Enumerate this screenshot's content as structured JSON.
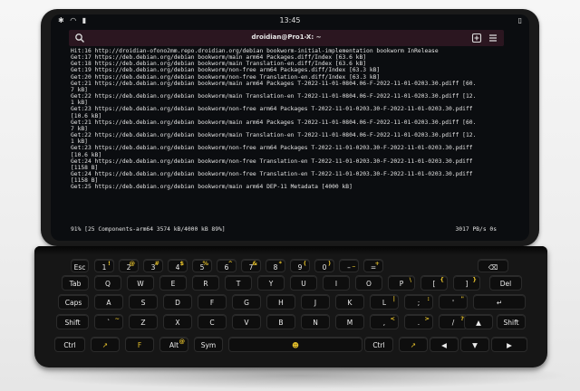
{
  "status": {
    "left_icons": [
      "bluetooth-icon",
      "wifi-icon",
      "signal-icon"
    ],
    "time": "13:45"
  },
  "terminal": {
    "title": "droidian@Pro1-X: ~",
    "lines": [
      "Hit:16 http://droidian-ofono2mm.repo.droidian.org/debian bookworm-initial-implementation bookworm InRelease",
      "Get:17 https://deb.debian.org/debian bookworm/main arm64 Packages.diff/Index [63.6 kB]",
      "Get:18 https://deb.debian.org/debian bookworm/main Translation-en.diff/Index [63.6 kB]",
      "Get:19 https://deb.debian.org/debian bookworm/non-free arm64 Packages.diff/Index [63.3 kB]",
      "Get:20 https://deb.debian.org/debian bookworm/non-free Translation-en.diff/Index [63.3 kB]",
      "Get:21 https://deb.debian.org/debian bookworm/main arm64 Packages T-2022-11-01-0804.06-F-2022-11-01-0203.30.pdiff [60.",
      "7 kB]",
      "Get:22 https://deb.debian.org/debian bookworm/main Translation-en T-2022-11-01-0804.06-F-2022-11-01-0203.30.pdiff [12.",
      "1 kB]",
      "Get:23 https://deb.debian.org/debian bookworm/non-free arm64 Packages T-2022-11-01-0203.30-F-2022-11-01-0203.30.pdiff",
      "[10.6 kB]",
      "Get:21 https://deb.debian.org/debian bookworm/main arm64 Packages T-2022-11-01-0804.06-F-2022-11-01-0203.30.pdiff [60.",
      "7 kB]",
      "Get:22 https://deb.debian.org/debian bookworm/main Translation-en T-2022-11-01-0804.06-F-2022-11-01-0203.30.pdiff [12.",
      "1 kB]",
      "Get:23 https://deb.debian.org/debian bookworm/non-free arm64 Packages T-2022-11-01-0203.30-F-2022-11-01-0203.30.pdiff",
      "[10.6 kB]",
      "Get:24 https://deb.debian.org/debian bookworm/non-free Translation-en T-2022-11-01-0203.30-F-2022-11-01-0203.30.pdiff",
      "[1158 B]",
      "Get:24 https://deb.debian.org/debian bookworm/non-free Translation-en T-2022-11-01-0203.30-F-2022-11-01-0203.30.pdiff",
      "[1158 B]",
      "Get:25 https://deb.debian.org/debian bookworm/main arm64 DEP-11 Metadata [4000 kB]"
    ],
    "progress": "91% [25 Components-arm64 3574 kB/4000 kB 89%]",
    "rate": "3017 PB/s 0s"
  },
  "keyboard": {
    "rows": [
      [
        {
          "id": "esc",
          "main": "Esc",
          "sub": ""
        },
        {
          "id": "1",
          "main": "1",
          "sub": "!"
        },
        {
          "id": "2",
          "main": "2",
          "sub": "@"
        },
        {
          "id": "3",
          "main": "3",
          "sub": "#"
        },
        {
          "id": "4",
          "main": "4",
          "sub": "$"
        },
        {
          "id": "5",
          "main": "5",
          "sub": "%"
        },
        {
          "id": "6",
          "main": "6",
          "sub": "^"
        },
        {
          "id": "7",
          "main": "7",
          "sub": "&"
        },
        {
          "id": "8",
          "main": "8",
          "sub": "*"
        },
        {
          "id": "9",
          "main": "9",
          "sub": "("
        },
        {
          "id": "0",
          "main": "0",
          "sub": ")"
        },
        {
          "id": "minus",
          "main": "–",
          "sub": "_"
        },
        {
          "id": "equals",
          "main": "=",
          "sub": "+"
        },
        {
          "id": "backspace",
          "main": "⌫",
          "sub": ""
        }
      ],
      [
        {
          "id": "tab",
          "main": "Tab",
          "sub": ""
        },
        {
          "id": "q",
          "main": "Q",
          "sub": ""
        },
        {
          "id": "w",
          "main": "W",
          "sub": ""
        },
        {
          "id": "e",
          "main": "E",
          "sub": ""
        },
        {
          "id": "r",
          "main": "R",
          "sub": ""
        },
        {
          "id": "t",
          "main": "T",
          "sub": ""
        },
        {
          "id": "y",
          "main": "Y",
          "sub": ""
        },
        {
          "id": "u",
          "main": "U",
          "sub": ""
        },
        {
          "id": "i",
          "main": "I",
          "sub": ""
        },
        {
          "id": "o",
          "main": "O",
          "sub": ""
        },
        {
          "id": "p",
          "main": "P",
          "sub": "\\"
        },
        {
          "id": "lbracket",
          "main": "[",
          "sub": "{"
        },
        {
          "id": "rbracket",
          "main": "]",
          "sub": "}"
        },
        {
          "id": "del",
          "main": "Del",
          "sub": ""
        }
      ],
      [
        {
          "id": "caps",
          "main": "Caps",
          "sub": ""
        },
        {
          "id": "a",
          "main": "A",
          "sub": ""
        },
        {
          "id": "s",
          "main": "S",
          "sub": ""
        },
        {
          "id": "d",
          "main": "D",
          "sub": ""
        },
        {
          "id": "f",
          "main": "F",
          "sub": ""
        },
        {
          "id": "g",
          "main": "G",
          "sub": ""
        },
        {
          "id": "h",
          "main": "H",
          "sub": ""
        },
        {
          "id": "j",
          "main": "J",
          "sub": ""
        },
        {
          "id": "k",
          "main": "K",
          "sub": ""
        },
        {
          "id": "l",
          "main": "L",
          "sub": "|"
        },
        {
          "id": "semicolon",
          "main": ";",
          "sub": ":"
        },
        {
          "id": "quote",
          "main": "'",
          "sub": "\""
        },
        {
          "id": "enter",
          "main": "↵",
          "sub": ""
        }
      ],
      [
        {
          "id": "shift-left",
          "main": "Shift",
          "sub": ""
        },
        {
          "id": "backtick",
          "main": "`",
          "sub": "~"
        },
        {
          "id": "z",
          "main": "Z",
          "sub": ""
        },
        {
          "id": "x",
          "main": "X",
          "sub": ""
        },
        {
          "id": "c",
          "main": "C",
          "sub": ""
        },
        {
          "id": "v",
          "main": "V",
          "sub": ""
        },
        {
          "id": "b",
          "main": "B",
          "sub": ""
        },
        {
          "id": "n",
          "main": "N",
          "sub": ""
        },
        {
          "id": "m",
          "main": "M",
          "sub": ""
        },
        {
          "id": "comma",
          "main": ",",
          "sub": "<"
        },
        {
          "id": "period",
          "main": ".",
          "sub": ">"
        },
        {
          "id": "slash",
          "main": "/",
          "sub": "?"
        },
        {
          "id": "up",
          "main": "▲",
          "sub": ""
        },
        {
          "id": "shift-right",
          "main": "Shift",
          "sub": ""
        }
      ],
      [
        {
          "id": "ctrl-left",
          "main": "Ctrl",
          "sub": ""
        },
        {
          "id": "fn-arrow",
          "main": "↗",
          "sub": ""
        },
        {
          "id": "fxtec",
          "main": "F",
          "sub": ""
        },
        {
          "id": "alt",
          "main": "Alt",
          "sub": "@"
        },
        {
          "id": "sym",
          "main": "Sym",
          "sub": ""
        },
        {
          "id": "space",
          "main": "☻",
          "sub": ""
        },
        {
          "id": "ctrl-right",
          "main": "Ctrl",
          "sub": ""
        },
        {
          "id": "fn-arrow-right",
          "main": "↗",
          "sub": ""
        },
        {
          "id": "left",
          "main": "◀",
          "sub": ""
        },
        {
          "id": "down",
          "main": "▼",
          "sub": ""
        },
        {
          "id": "right",
          "main": "▶",
          "sub": ""
        }
      ]
    ]
  }
}
